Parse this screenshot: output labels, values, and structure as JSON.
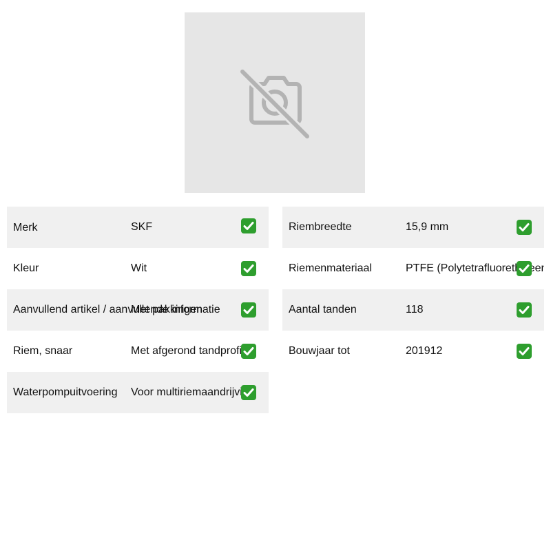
{
  "product_image": {
    "icon": "camera-off-icon"
  },
  "left_specs": [
    {
      "label": "Merk",
      "value": "SKF"
    },
    {
      "label": "Kleur",
      "value": "Wit"
    },
    {
      "label": "Aanvullend artikel / aanvullende informatie",
      "value": "Met pakkingen"
    },
    {
      "label": "Riem, snaar",
      "value": "Met afgerond tandprofiel"
    },
    {
      "label": "Waterpompuitvoering",
      "value": "Voor multiriemaandrijving"
    }
  ],
  "right_specs": [
    {
      "label": "Riembreedte",
      "value": "15,9 mm"
    },
    {
      "label": "Riemenmateriaal",
      "value": "PTFE (Polytetrafluorethyleen)"
    },
    {
      "label": "Aantal tanden",
      "value": "118"
    },
    {
      "label": "Bouwjaar tot",
      "value": "201912"
    }
  ],
  "check_icon": "check-mark-icon",
  "colors": {
    "row_shade": "#f0f0f0",
    "placeholder_bg": "#e6e6e6",
    "placeholder_icon": "#b3b3b3",
    "check_green": "#2e9e2e"
  }
}
